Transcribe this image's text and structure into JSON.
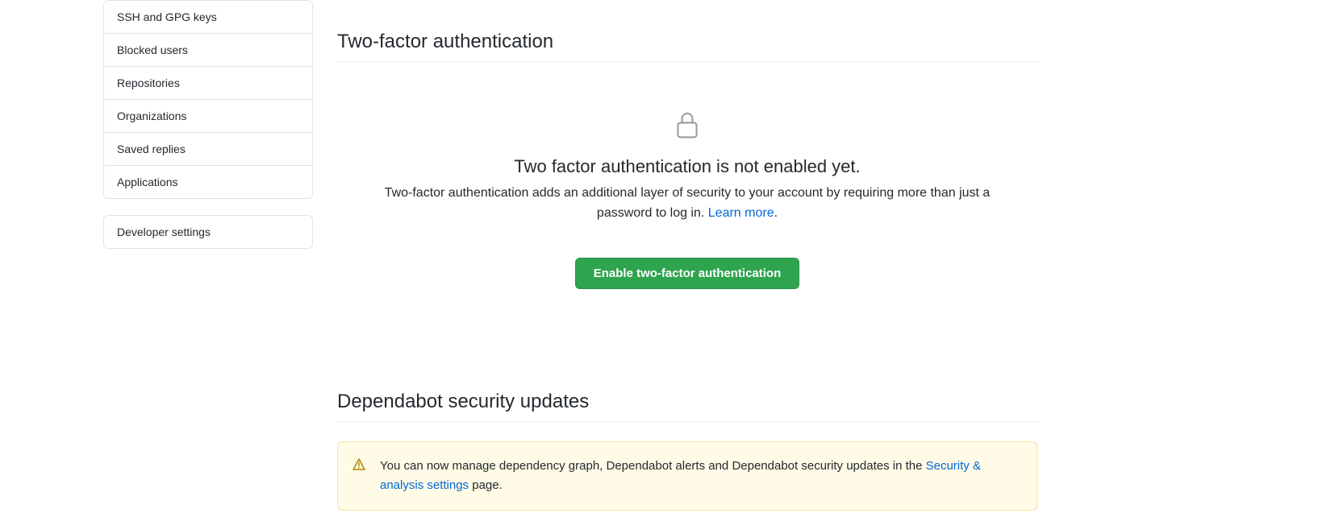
{
  "sidebar": {
    "group1": [
      {
        "label": "SSH and GPG keys"
      },
      {
        "label": "Blocked users"
      },
      {
        "label": "Repositories"
      },
      {
        "label": "Organizations"
      },
      {
        "label": "Saved replies"
      },
      {
        "label": "Applications"
      }
    ],
    "group2": [
      {
        "label": "Developer settings"
      }
    ]
  },
  "tfa": {
    "heading": "Two-factor authentication",
    "title": "Two factor authentication is not enabled yet.",
    "desc_prefix": "Two-factor authentication adds an additional layer of security to your account by requiring more than just a password to log in. ",
    "learn_more": "Learn more",
    "desc_suffix": ".",
    "button": "Enable two-factor authentication"
  },
  "dependabot": {
    "heading": "Dependabot security updates",
    "warn_prefix": "You can now manage dependency graph, Dependabot alerts and Dependabot security updates in the ",
    "warn_link": "Security & analysis settings",
    "warn_suffix": " page."
  }
}
